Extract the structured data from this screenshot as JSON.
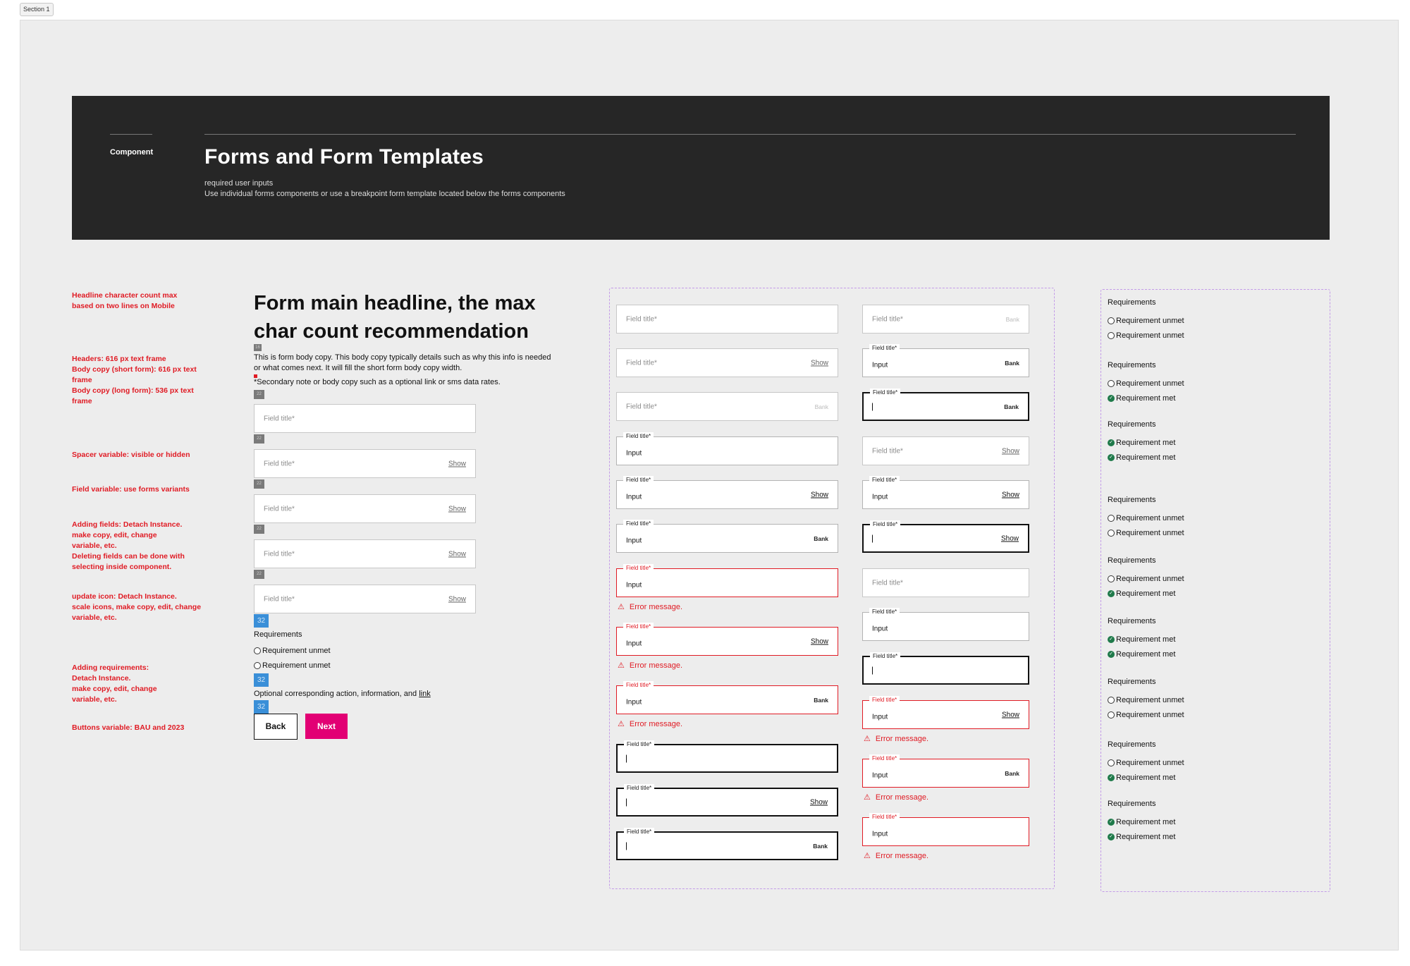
{
  "section_label": "Section 1",
  "header": {
    "kicker": "Component",
    "title": "Forms and Form Templates",
    "sub1": "required user inputs",
    "sub2": "Use individual forms components or use a breakpoint form template located below the forms components"
  },
  "notes": [
    "Headline character count max\nbased on two lines on Mobile",
    "Headers: 616 px text frame\nBody copy (short form): 616 px text\nframe\nBody copy (long form): 536 px text\nframe",
    "Spacer variable: visible or hidden",
    "Field variable: use forms variants",
    "Adding fields: Detach Instance.\nmake copy, edit, change\nvariable, etc.\nDeleting fields can be done with\nselecting inside component.",
    "update icon: Detach Instance.\nscale icons, make copy, edit, change\nvariable, etc.",
    "Adding requirements:\nDetach Instance.\nmake copy, edit, change\nvariable, etc.",
    "Buttons variable: BAU and 2023"
  ],
  "form": {
    "headline": "Form main headline, the max char count recommendation",
    "body": "This is form body copy. This body copy typically details such as why this info is needed or what comes next. It will fill the short form body copy width.",
    "secondary": "*Secondary note or body copy such as a optional link or sms data rates.",
    "spacer_small": "22",
    "spacer_tiny": "16",
    "spacer_large": "32",
    "field_placeholder": "Field title*",
    "show": "Show",
    "requirements_title": "Requirements",
    "req_unmet": "Requirement unmet",
    "optional_text": "Optional corresponding action, information, and ",
    "optional_link": "link",
    "back": "Back",
    "next": "Next"
  },
  "variants": {
    "placeholder": "Field title*",
    "label": "Field title*",
    "input": "Input",
    "show": "Show",
    "bank": "Bank",
    "error": "Error message."
  },
  "requirements": {
    "title": "Requirements",
    "unmet": "Requirement unmet",
    "met": "Requirement met"
  },
  "colors": {
    "hero_bg": "#262626",
    "accent_magenta": "#e20074",
    "error_red": "#e01b24",
    "met_green": "#1f7a4a",
    "spacer_blue": "#3a8fd8",
    "frame_dash": "#c39be8"
  }
}
